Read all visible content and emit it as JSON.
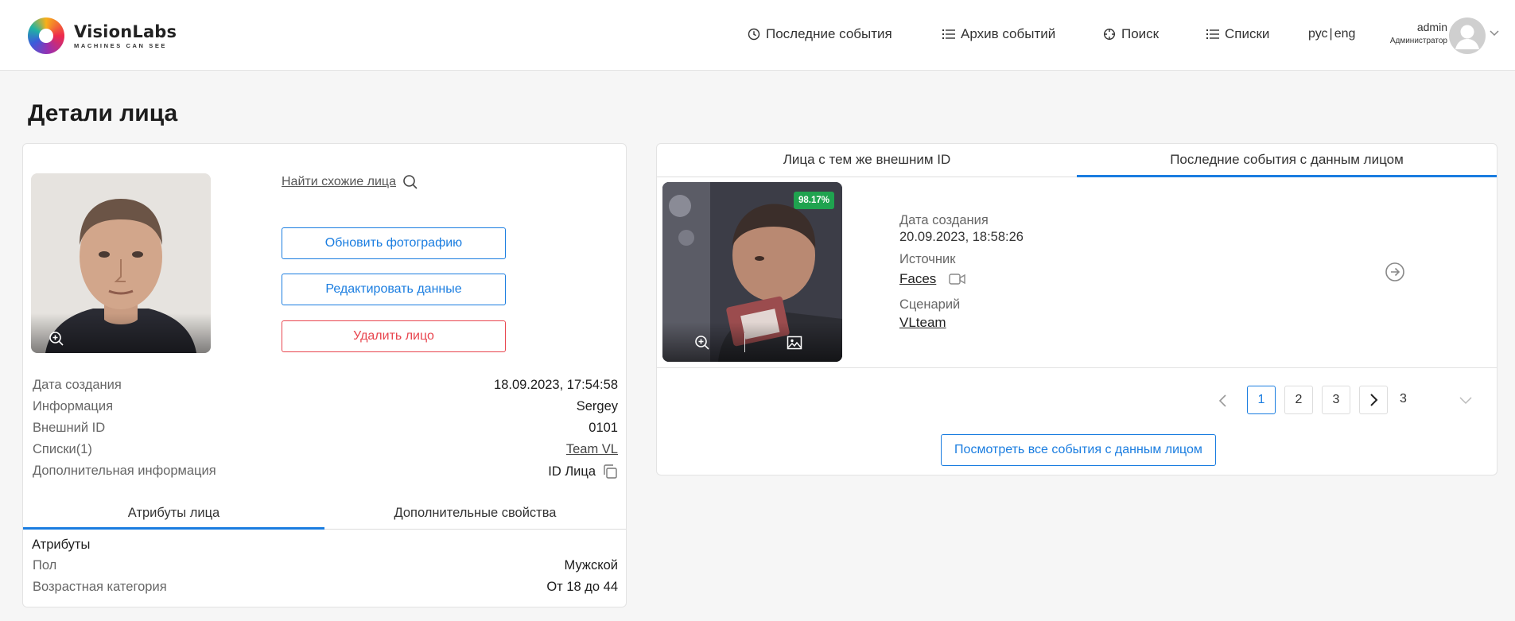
{
  "app": {
    "brand_name": "VisionLabs",
    "brand_tagline": "MACHINES CAN SEE"
  },
  "nav": {
    "items": [
      {
        "label": "Последние события",
        "icon": "clock-icon"
      },
      {
        "label": "Архив событий",
        "icon": "list-icon"
      },
      {
        "label": "Поиск",
        "icon": "crosshair-icon"
      },
      {
        "label": "Списки",
        "icon": "list-icon"
      }
    ],
    "lang_ru": "рус",
    "lang_en": "eng",
    "user_name": "admin",
    "user_role": "Администратор"
  },
  "page": {
    "title": "Детали лица"
  },
  "face": {
    "find_similar": "Найти схожие лица",
    "update_photo": "Обновить фотографию",
    "edit_data": "Редактировать данные",
    "delete_face": "Удалить лицо",
    "info": [
      {
        "label": "Дата создания",
        "value": "18.09.2023, 17:54:58"
      },
      {
        "label": "Информация",
        "value": "Sergey"
      },
      {
        "label": "Внешний ID",
        "value": "0101"
      },
      {
        "label": "Списки(1)",
        "value": "Team VL"
      },
      {
        "label": "Дополнительная информация",
        "value": "ID Лица"
      }
    ],
    "tabs": [
      "Атрибуты лица",
      "Дополнительные свойства"
    ],
    "attributes_title": "Атрибуты",
    "attributes": [
      {
        "label": "Пол",
        "value": "Мужской"
      },
      {
        "label": "Возрастная категория",
        "value": "От 18 до 44"
      }
    ]
  },
  "events": {
    "tabs": [
      "Лица с тем же внешним ID",
      "Последние события с данным лицом"
    ],
    "score": "98.17%",
    "created_label": "Дата создания",
    "created_value": "20.09.2023, 18:58:26",
    "source_label": "Источник",
    "source_value": "Faces",
    "scenario_label": "Сценарий",
    "scenario_value": "VLteam",
    "pages": [
      "1",
      "2",
      "3"
    ],
    "current_page": "1",
    "total_pages": "3",
    "view_all": "Посмотреть все события с данным лицом"
  },
  "colors": {
    "accent": "#1a7de0",
    "danger": "#e8454e",
    "score_badge": "#1fa34f"
  }
}
